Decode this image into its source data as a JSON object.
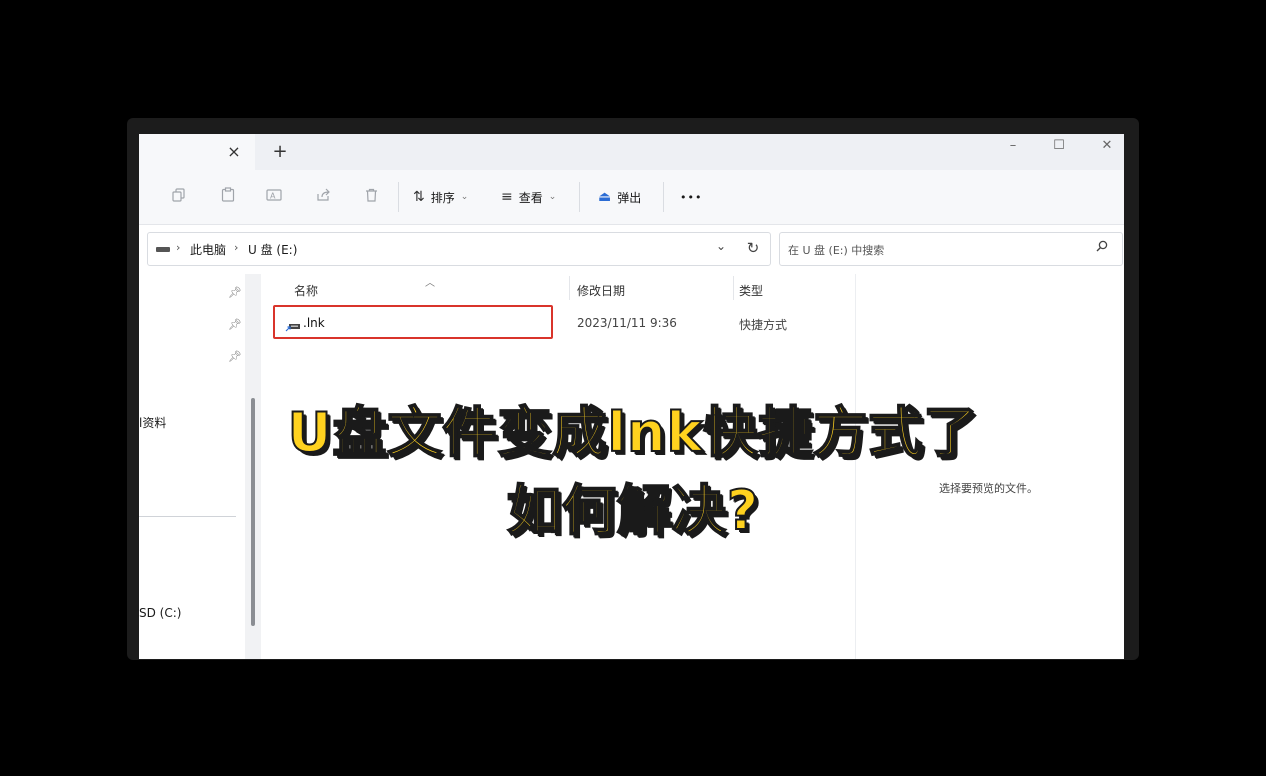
{
  "titlebar": {
    "tab_close": "×",
    "tab_add": "+",
    "minimize": "–",
    "maximize": "☐",
    "close": "✕"
  },
  "toolbar": {
    "icons": [
      "copy-icon",
      "paste-icon",
      "rename-icon",
      "share-icon",
      "delete-icon"
    ],
    "sort_label": "排序",
    "view_label": "查看",
    "eject_label": "弹出",
    "more_label": "•••"
  },
  "address": {
    "crumbs": [
      "此电脑",
      "U 盘 (E:)"
    ],
    "separator": "›"
  },
  "search": {
    "placeholder": "在 U 盘 (E:) 中搜索"
  },
  "nav": {
    "partial_items": [
      "l资料",
      "SD (C:)"
    ]
  },
  "columns": {
    "name": "名称",
    "date": "修改日期",
    "type": "类型"
  },
  "files": [
    {
      "name": ".lnk",
      "date": "2023/11/11 9:36",
      "type": "快捷方式"
    }
  ],
  "preview": {
    "empty_text": "选择要预览的文件。"
  },
  "caption": {
    "line1": "U盘文件变成lnk快捷方式了",
    "line2": "如何解决?"
  },
  "colors": {
    "caption_fill": "#ffd21f",
    "caption_stroke": "#1a1a1a",
    "highlight": "#d9342b"
  }
}
